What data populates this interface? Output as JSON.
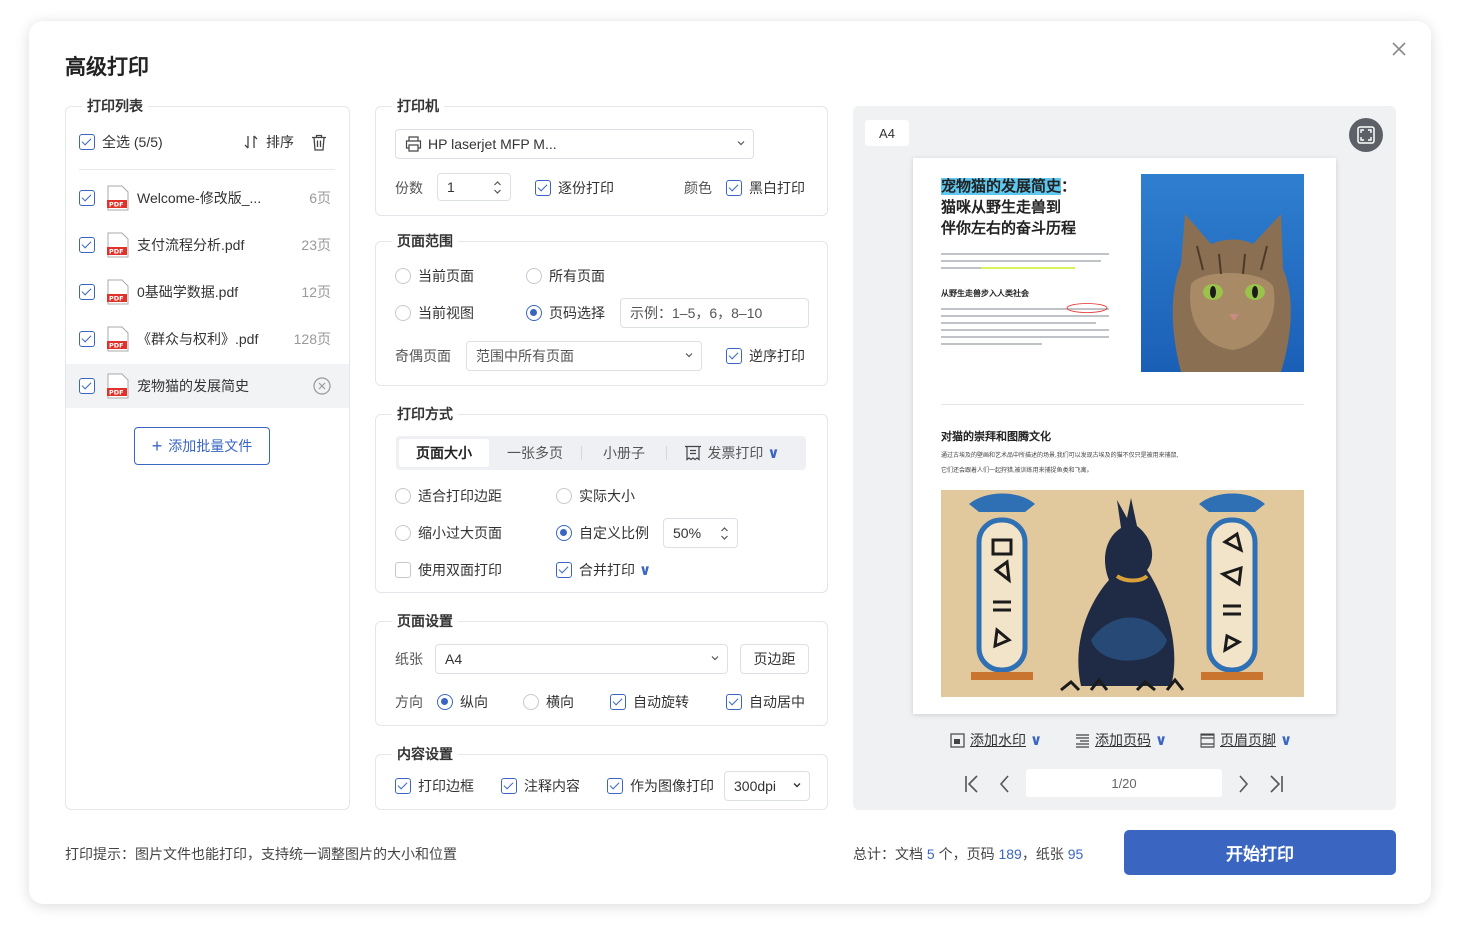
{
  "dialog": {
    "title": "高级打印"
  },
  "print_list": {
    "legend": "打印列表",
    "select_all": "全选 (5/5)",
    "sort": "排序",
    "files": [
      {
        "name": "Welcome-修改版_...",
        "pages": "6页",
        "checked": true,
        "selected": false
      },
      {
        "name": "支付流程分析.pdf",
        "pages": "23页",
        "checked": true,
        "selected": false
      },
      {
        "name": "0基础学数据.pdf",
        "pages": "12页",
        "checked": true,
        "selected": false
      },
      {
        "name": "《群众与权利》.pdf",
        "pages": "128页",
        "checked": true,
        "selected": false
      },
      {
        "name": "宠物猫的发展简史",
        "pages": "",
        "checked": true,
        "selected": true
      }
    ],
    "add_batch": "添加批量文件"
  },
  "printer": {
    "legend": "打印机",
    "name": "HP laserjet MFP M...",
    "copies_label": "份数",
    "copies": "1",
    "collate": "逐份打印",
    "color_label": "颜色",
    "bw": "黑白打印"
  },
  "page_range": {
    "legend": "页面范围",
    "current_page": "当前页面",
    "all_pages": "所有页面",
    "current_view": "当前视图",
    "page_select": "页码选择",
    "range_placeholder": "示例：1–5，6，8–10",
    "odd_even_label": "奇偶页面",
    "odd_even_value": "范围中所有页面",
    "reverse": "逆序打印"
  },
  "print_mode": {
    "legend": "打印方式",
    "tabs": [
      "页面大小",
      "一张多页",
      "小册子",
      "发票打印"
    ],
    "fit_margin": "适合打印边距",
    "actual_size": "实际大小",
    "shrink": "缩小过大页面",
    "custom_scale": "自定义比例",
    "scale": "50%",
    "duplex": "使用双面打印",
    "merge": "合并打印"
  },
  "page_setup": {
    "legend": "页面设置",
    "paper_label": "纸张",
    "paper": "A4",
    "margins": "页边距",
    "orientation_label": "方向",
    "portrait": "纵向",
    "landscape": "横向",
    "auto_rotate": "自动旋转",
    "auto_center": "自动居中"
  },
  "content": {
    "legend": "内容设置",
    "border": "打印边框",
    "annotations": "注释内容",
    "as_image": "作为图像打印",
    "dpi": "300dpi"
  },
  "preview": {
    "paper_badge": "A4",
    "doc_title_highlight": "宠物猫的发展简史",
    "doc_title_colon": "：",
    "doc_title_line2": "猫咪从野生走兽到",
    "doc_title_line3": "伴你左右的奋斗历程",
    "section1": "从野生走兽步入人类社会",
    "section2": "对猫的崇拜和图腾文化",
    "section2_text1": "通过古埃及的壁画和艺术品中所描述的场景,我们可以发现古埃及的猫不仅只是被用来捕鼠,",
    "section2_text2": "它们还会跟着人们一起狩猎,被训练用来捕捉鱼类和飞禽。",
    "add_watermark": "添加水印",
    "add_page_number": "添加页码",
    "header_footer": "页眉页脚",
    "page_indicator": "1/20"
  },
  "footer": {
    "tip": "打印提示：图片文件也能打印，支持统一调整图片的大小和位置",
    "total_prefix": "总计：文档",
    "docs": "5",
    "docs_unit": "个，页码",
    "pages": "189",
    "sheets_prefix": "，纸张",
    "sheets": "95",
    "start": "开始打印"
  },
  "colors": {
    "accent": "#3a66c2",
    "highlight": "#5ec8f0",
    "green_mark": "#d6f35a"
  }
}
